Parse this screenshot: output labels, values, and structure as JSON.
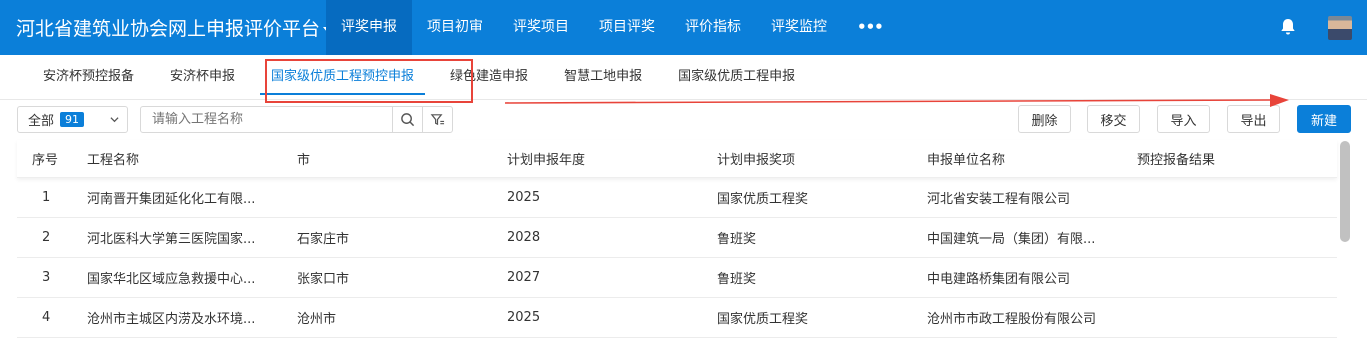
{
  "header": {
    "app_title": "河北省建筑业协会网上申报评价平台",
    "nav": [
      {
        "label": "评奖申报",
        "active": true
      },
      {
        "label": "项目初审"
      },
      {
        "label": "评奖项目"
      },
      {
        "label": "项目评奖"
      },
      {
        "label": "评价指标"
      },
      {
        "label": "评奖监控"
      }
    ],
    "more_label": "•••",
    "bell_icon": "bell-icon",
    "avatar_icon": "user-avatar"
  },
  "subtabs": [
    {
      "label": "安济杯预控报备"
    },
    {
      "label": "安济杯申报"
    },
    {
      "label": "国家级优质工程预控申报",
      "active": true
    },
    {
      "label": "绿色建造申报"
    },
    {
      "label": "智慧工地申报"
    },
    {
      "label": "国家级优质工程申报"
    }
  ],
  "toolbar": {
    "filter_label": "全部",
    "filter_count": "91",
    "search_placeholder": "请输入工程名称",
    "delete_label": "删除",
    "transfer_label": "移交",
    "import_label": "导入",
    "export_label": "导出",
    "new_label": "新建"
  },
  "table": {
    "columns": [
      "序号",
      "工程名称",
      "市",
      "计划申报年度",
      "计划申报奖项",
      "申报单位名称",
      "预控报备结果"
    ],
    "rows": [
      [
        "1",
        "河南晋开集团延化化工有限...",
        "",
        "2025",
        "国家优质工程奖",
        "河北省安装工程有限公司",
        ""
      ],
      [
        "2",
        "河北医科大学第三医院国家...",
        "石家庄市",
        "2028",
        "鲁班奖",
        "中国建筑一局（集团）有限...",
        ""
      ],
      [
        "3",
        "国家华北区域应急救援中心...",
        "张家口市",
        "2027",
        "鲁班奖",
        "中电建路桥集团有限公司",
        ""
      ],
      [
        "4",
        "沧州市主城区内涝及水环境...",
        "沧州市",
        "2025",
        "国家优质工程奖",
        "沧州市市政工程股份有限公司",
        ""
      ]
    ]
  },
  "colors": {
    "primary": "#0b7fd9",
    "highlight": "#e8443a"
  }
}
